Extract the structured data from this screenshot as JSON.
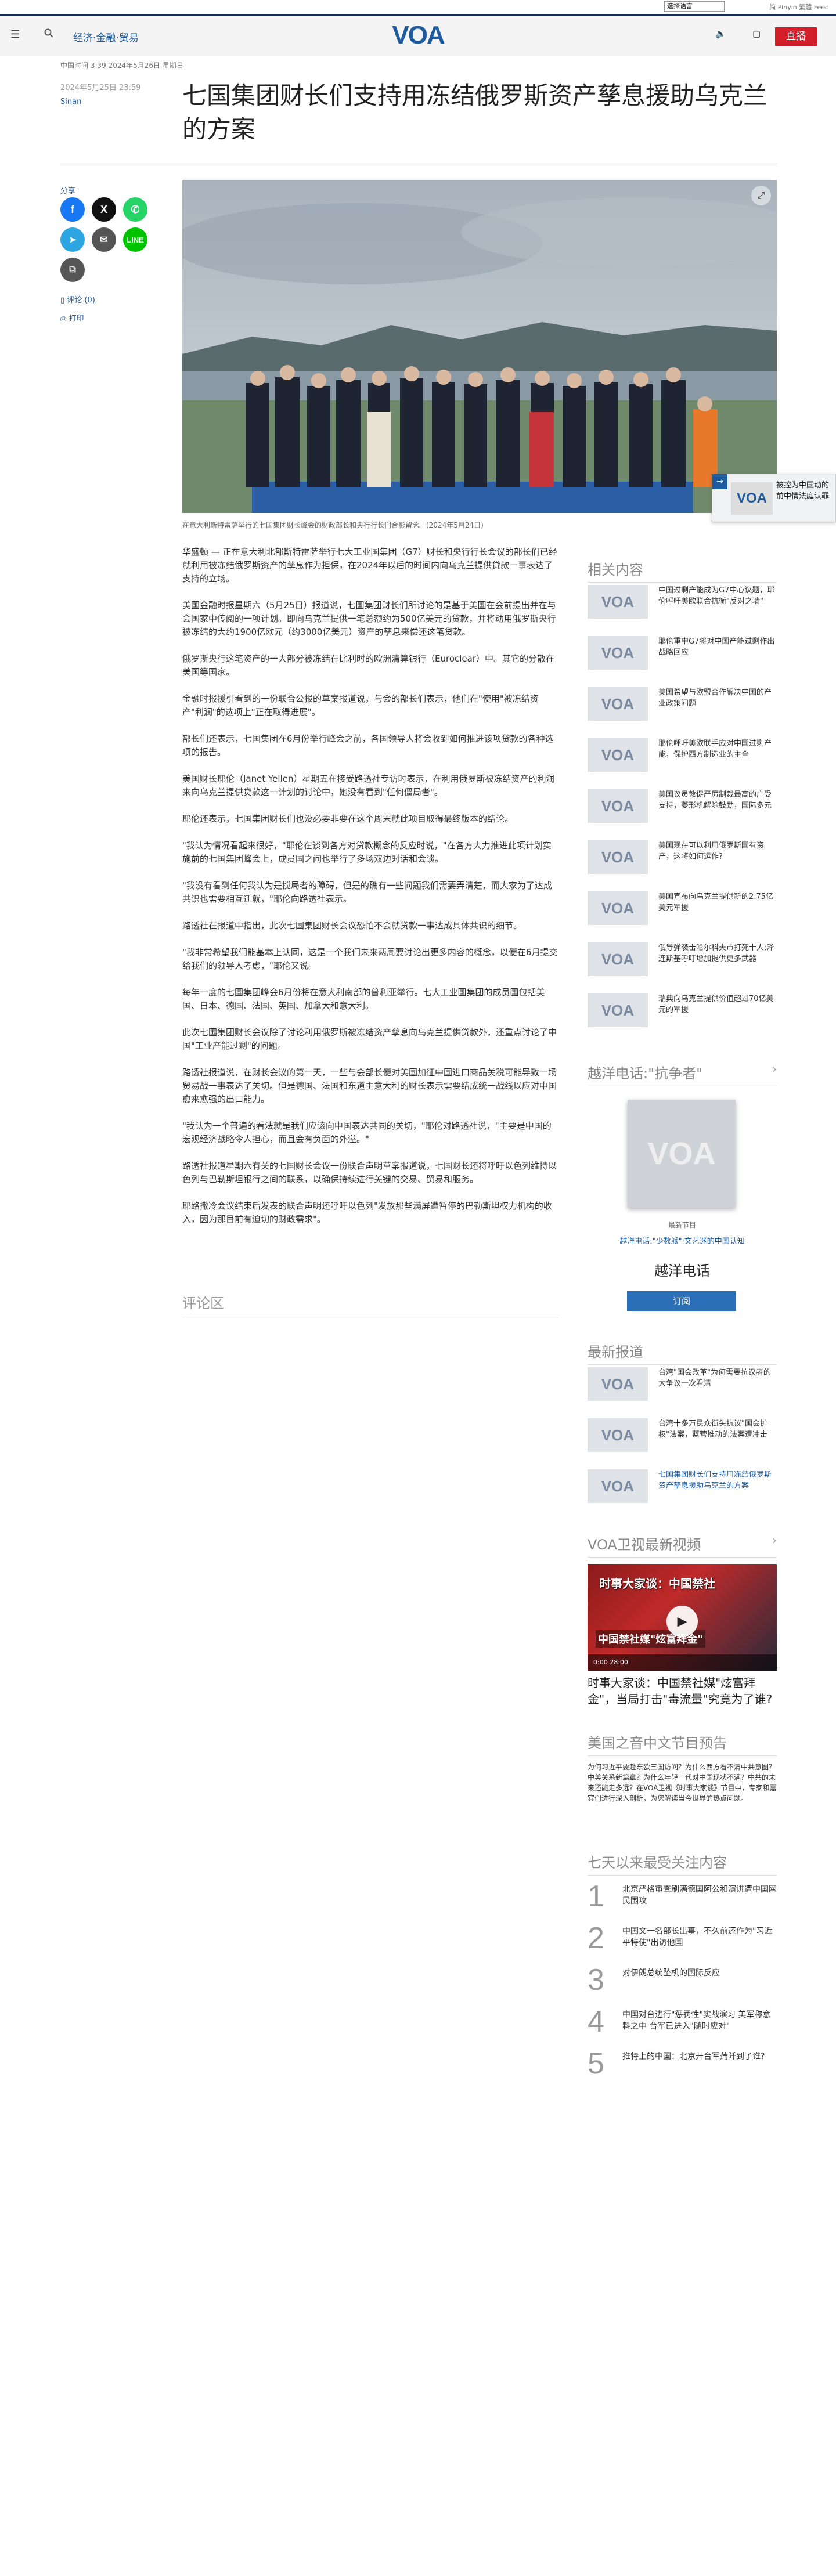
{
  "topbar": {
    "lang_select": "选择语言",
    "lang_links": "简 Pinyin 繁體 Feed"
  },
  "header": {
    "menu_icon": "menu-icon",
    "search_icon": "search-icon",
    "nav_link": "经济·金融·贸易",
    "logo": "VOA",
    "live_label": "直播"
  },
  "article": {
    "meta_time": "中国时间 3:39 2024年5月26日 星期日",
    "pubdate": "2024年5月25日 23:59",
    "author": "Sinan",
    "title": "七国集团财长们支持用冻结俄罗斯资产孳息援助乌克兰的方案",
    "share_label": "分享",
    "comments_link": "评论 (0)",
    "print_link": "打印",
    "caption": "在意大利斯特雷萨举行的七国集团财长峰会的财政部长和央行行长们合影留念。(2024年5月24日)",
    "paragraphs": [
      "华盛顿 — 正在意大利北部斯特雷萨举行七大工业国集团（G7）财长和央行行长会议的部长们已经就利用被冻结俄罗斯资产的孳息作为担保，在2024年以后的时间内向乌克兰提供贷款一事表达了支持的立场。",
      "美国金融时报星期六（5月25日）报道说，七国集团财长们所讨论的是基于美国在会前提出并在与会国家中传阅的一项计划。即向乌克兰提供一笔总额约为500亿美元的贷款，并将动用俄罗斯央行被冻结的大约1900亿欧元（约3000亿美元）资产的孳息来偿还这笔贷款。",
      "俄罗斯央行这笔资产的一大部分被冻结在比利时的欧洲清算银行（Euroclear）中。其它的分散在美国等国家。",
      "金融时报援引看到的一份联合公报的草案报道说，与会的部长们表示，他们在\"使用\"被冻结资产\"利润\"的选项上\"正在取得进展\"。",
      "部长们还表示，七国集团在6月份举行峰会之前，各国领导人将会收到如何推进该项贷款的各种选项的报告。",
      "美国财长耶伦（Janet Yellen）星期五在接受路透社专访时表示，在利用俄罗斯被冻结资产的利润来向乌克兰提供贷款这一计划的讨论中，她没有看到\"任何僵局者\"。",
      "耶伦还表示，七国集团财长们也没必要非要在这个周末就此项目取得最终版本的结论。",
      "\"我认为情况看起来很好，\"耶伦在谈到各方对贷款概念的反应时说，\"在各方大力推进此项计划实施前的七国集团峰会上，成员国之间也举行了多场双边对话和会谈。",
      "\"我没有看到任何我认为是搅局者的障碍，但是的确有一些问题我们需要弄清楚，而大家为了达成共识也需要相互迁就，\"耶伦向路透社表示。",
      "路透社在报道中指出，此次七国集团财长会议恐怕不会就贷款一事达成具体共识的细节。",
      "\"我非常希望我们能基本上认同，这是一个我们未来两周要讨论出更多内容的概念，以便在6月提交给我们的领导人考虑，\"耶伦又说。",
      "每年一度的七国集团峰会6月份将在意大利南部的普利亚举行。七大工业国集团的成员国包括美国、日本、德国、法国、英国、加拿大和意大利。",
      "此次七国集团财长会议除了讨论利用俄罗斯被冻结资产孳息向乌克兰提供贷款外，还重点讨论了中国\"工业产能过剩\"的问题。",
      "路透社报道说，在财长会议的第一天，一些与会部长便对美国加征中国进口商品关税可能导致一场贸易战一事表达了关切。但是德国、法国和东道主意大利的财长表示需要结成统一战线以应对中国愈来愈强的出口能力。",
      "\"我认为一个普遍的看法就是我们应该向中国表达共同的关切，\"耶伦对路透社说，\"主要是中国的宏观经济战略令人担心，而且会有负面的外溢。\"",
      "路透社报道星期六有关的七国财长会议一份联合声明草案报道说，七国财长还将呼吁以色列维持以色列与巴勒斯坦银行之间的联系，以确保持续进行关键的交易、贸易和服务。",
      "耶路撒冷会议结束后发表的联合声明还呼吁以色列\"发放那些满屏遭暂停的巴勒斯坦权力机构的收入，因为那目前有迫切的财政需求\"。"
    ],
    "comments_title": "评论区"
  },
  "float_card": {
    "arrow": "→",
    "logo": "VOA",
    "text": "被控为中国动的前中情法庭认罪"
  },
  "related": {
    "title": "相关内容",
    "items": [
      {
        "text": "中国过剩产能成为G7中心议题，耶伦呼吁美欧联合抗衡\"反对之墙\""
      },
      {
        "text": "耶伦重申G7将对中国产能过剩作出战略回应"
      },
      {
        "text": "美国希望与欧盟合作解决中国的产业政策问题"
      },
      {
        "text": "耶伦呼吁美欧联手应对中国过剩产能，保护西方制造业的主全"
      },
      {
        "text": "美国议员敦促严厉制裁最高的广受支持，菱形机解除鼓励，国际多元"
      },
      {
        "text": "美国现在可以利用俄罗斯国有资产，这将如何运作?"
      },
      {
        "text": "美国宣布向乌克兰提供新的2.75亿美元军援"
      },
      {
        "text": "俄导弹袭击哈尔科夫市打死十人;泽连斯基呼吁增加提供更多武器"
      },
      {
        "text": "瑞典向乌克兰提供价值超过70亿美元的军援"
      }
    ]
  },
  "podcast": {
    "section_title": "越洋电话:\"抗争者\"",
    "cover_text": "VOA",
    "latest_label": "最新节目",
    "episode_link": "越洋电话:\"少数派\"·文艺迷的中国认知",
    "show_name": "越洋电话",
    "subscribe": "订阅"
  },
  "latest": {
    "title": "最新报道",
    "items": [
      {
        "text": "台湾\"国会改革\"为何需要抗议者的大争议一次看清"
      },
      {
        "text": "台湾十多万民众街头抗议\"国会扩权\"法案，蓝营推动的法案遭冲击"
      },
      {
        "text": "七国集团财长们支持用冻结俄罗斯资产孳息援助乌克兰的方案",
        "blue": true
      }
    ]
  },
  "video": {
    "section_title": "VOA卫视最新视频",
    "overlay_title": "时事大家谈：中国禁社",
    "overlay_sub": "中国禁社媒\"炫富拜金\"",
    "play_icon": "play-icon",
    "time": "0:00   28:00",
    "caption": "时事大家谈：中国禁社媒\"炫富拜金\"，当局打击\"毒流量\"究竟为了谁?"
  },
  "preview": {
    "title": "美国之音中文节目预告",
    "text": "为何习近平要赴东欧三国访问？为什么西方看不清中共意图？中美关系新篇章？为什么年轻一代对中国现状不满？中共的未来还能走多远？在VOA卫视《时事大家谈》节目中，专家和嘉宾们进行深入剖析，为您解读当今世界的热点问题。"
  },
  "popular": {
    "title": "七天以来最受关注内容",
    "items": [
      {
        "n": "1",
        "text": "北京严格审查刷满德国阿公和演讲遭中国网民围攻"
      },
      {
        "n": "2",
        "text": "中国文一名部长出事，不久前还作为\"习近平特使\"出访他国"
      },
      {
        "n": "3",
        "text": "对伊朗总统坠机的国际反应"
      },
      {
        "n": "4",
        "text": "中国对台进行\"惩罚性\"实战演习 美军称意料之中 台军已进入\"随时应对\""
      },
      {
        "n": "5",
        "text": "推特上的中国：北京开台军蒲阡到了谁?"
      }
    ]
  }
}
